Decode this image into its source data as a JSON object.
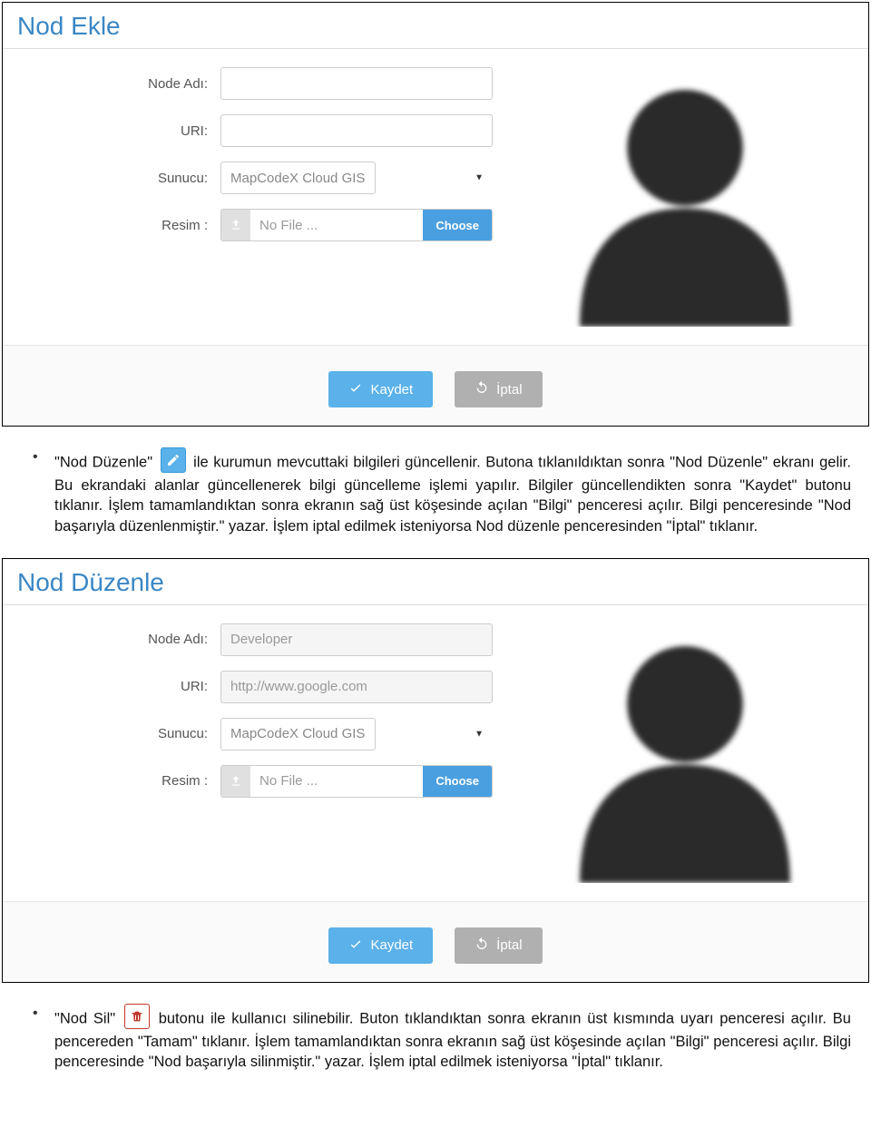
{
  "panel_add": {
    "title": "Nod Ekle",
    "labels": {
      "node_name": "Node Adı:",
      "uri": "URI:",
      "server": "Sunucu:",
      "image": "Resim :"
    },
    "values": {
      "node_name": "",
      "uri": "",
      "server": "MapCodeX Cloud GIS",
      "file_text": "No File ..."
    },
    "buttons": {
      "choose": "Choose",
      "save": "Kaydet",
      "cancel": "İptal"
    }
  },
  "panel_edit": {
    "title": "Nod Düzenle",
    "labels": {
      "node_name": "Node Adı:",
      "uri": "URI:",
      "server": "Sunucu:",
      "image": "Resim :"
    },
    "values": {
      "node_name": "Developer",
      "uri": "http://www.google.com",
      "server": "MapCodeX Cloud GIS",
      "file_text": "No File ..."
    },
    "buttons": {
      "choose": "Choose",
      "save": "Kaydet",
      "cancel": "İptal"
    }
  },
  "paragraphs": {
    "edit_desc_prefix": "\"Nod Düzenle\" ",
    "edit_desc_suffix": " ile kurumun  mevcuttaki bilgileri güncellenir. Butona tıklanıldıktan sonra \"Nod Düzenle\" ekranı gelir. Bu ekrandaki alanlar güncellenerek bilgi güncelleme işlemi yapılır. Bilgiler güncellendikten sonra \"Kaydet\" butonu tıklanır. İşlem tamamlandıktan sonra ekranın sağ üst köşesinde açılan \"Bilgi\" penceresi açılır. Bilgi penceresinde \"Nod başarıyla düzenlenmiştir.\" yazar. İşlem iptal edilmek isteniyorsa Nod düzenle penceresinden \"İptal\" tıklanır.",
    "delete_desc_prefix": "\"Nod Sil\" ",
    "delete_desc_suffix": " butonu ile kullanıcı silinebilir. Buton tıklandıktan sonra ekranın üst kısmında uyarı penceresi açılır. Bu pencereden \"Tamam\" tıklanır. İşlem tamamlandıktan sonra ekranın sağ üst köşesinde açılan \"Bilgi\" penceresi açılır. Bilgi penceresinde \"Nod başarıyla silinmiştir.\" yazar. İşlem iptal edilmek isteniyorsa \"İptal\" tıklanır."
  }
}
